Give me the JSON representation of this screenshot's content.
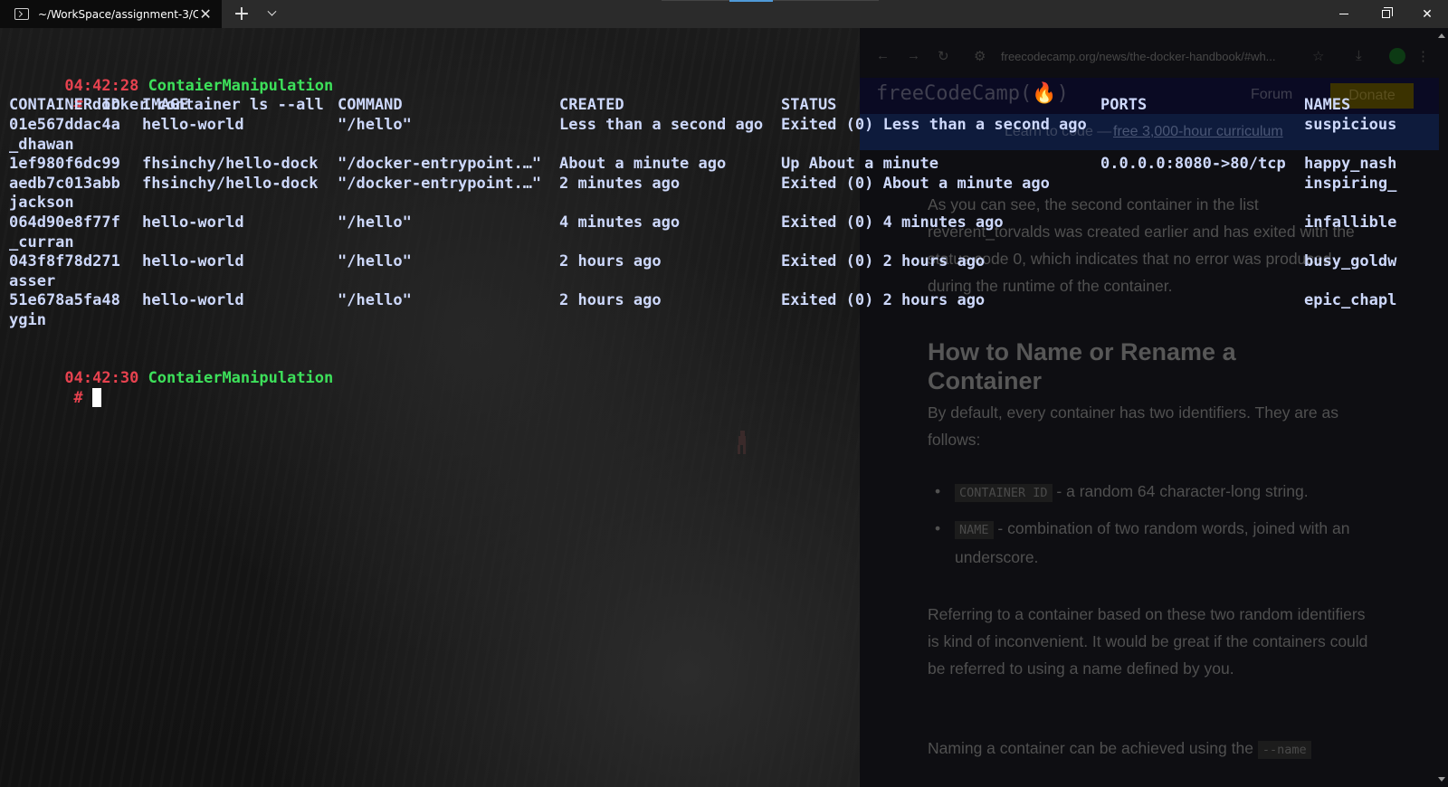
{
  "window": {
    "tab_title": "~/WorkSpace/assignment-3/C",
    "tab_close": "✕",
    "new_tab": "+",
    "close": "✕"
  },
  "terminal": {
    "prompt1": {
      "time": "04:42:28",
      "dir": "ContaierManipulation",
      "symbol": "#",
      "command": "docker container ls --all"
    },
    "headers": {
      "container_id": "CONTAINER ID",
      "image": "IMAGE",
      "command": "COMMAND",
      "created": "CREATED",
      "status": "STATUS",
      "ports": "PORTS",
      "names": "NAMES"
    },
    "rows": [
      {
        "id": "01e567ddac4a",
        "image": "hello-world",
        "command": "\"/hello\"",
        "created": "Less than a second ago",
        "status": "Exited (0) Less than a second ago",
        "ports": "",
        "name": "suspicious",
        "wrap": "_dhawan"
      },
      {
        "id": "1ef980f6dc99",
        "image": "fhsinchy/hello-dock",
        "command": "\"/docker-entrypoint.…\"",
        "created": "About a minute ago",
        "status": "Up About a minute",
        "ports": "0.0.0.0:8080->80/tcp",
        "name": "happy_nash",
        "wrap": ""
      },
      {
        "id": "aedb7c013abb",
        "image": "fhsinchy/hello-dock",
        "command": "\"/docker-entrypoint.…\"",
        "created": "2 minutes ago",
        "status": "Exited (0) About a minute ago",
        "ports": "",
        "name": "inspiring_",
        "wrap": "jackson"
      },
      {
        "id": "064d90e8f77f",
        "image": "hello-world",
        "command": "\"/hello\"",
        "created": "4 minutes ago",
        "status": "Exited (0) 4 minutes ago",
        "ports": "",
        "name": "infallible",
        "wrap": "_curran"
      },
      {
        "id": "043f8f78d271",
        "image": "hello-world",
        "command": "\"/hello\"",
        "created": "2 hours ago",
        "status": "Exited (0) 2 hours ago",
        "ports": "",
        "name": "busy_goldw",
        "wrap": "asser"
      },
      {
        "id": "51e678a5fa48",
        "image": "hello-world",
        "command": "\"/hello\"",
        "created": "2 hours ago",
        "status": "Exited (0) 2 hours ago",
        "ports": "",
        "name": "epic_chapl",
        "wrap": "ygin"
      }
    ],
    "prompt2": {
      "time": "04:42:30",
      "dir": "ContaierManipulation",
      "symbol": "#"
    }
  },
  "background_browser": {
    "url": "freecodecamp.org/news/the-docker-handbook/#wh...",
    "brand": "freeCodeCamp(🔥)",
    "forum": "Forum",
    "donate": "Donate",
    "banner_text": "Learn to code —",
    "banner_link": "free 3,000-hour curriculum",
    "para1": "As you can see, the second container in the list reverent_torvalds was created earlier and has exited with the status code 0, which indicates that no error was produced during the runtime of the container.",
    "heading": "How to Name or Rename a Container",
    "para2": "By default, every container has two identifiers. They are as follows:",
    "bullet1_code": "CONTAINER ID",
    "bullet1_text": "- a random 64 character-long string.",
    "bullet2_code": "NAME",
    "bullet2_text": "- combination of two random words, joined with an underscore.",
    "para3": "Referring to a container based on these two random identifiers is kind of inconvenient. It would be great if the containers could be referred to using a name defined by you.",
    "para4_text": "Naming a container can be achieved using the",
    "para4_code": "--name"
  },
  "colors": {
    "prompt_time": "#e7424f",
    "prompt_dir": "#3de05a",
    "output_text": "#cdd8fb",
    "titlebar": "#2b2b2b",
    "terminal_bg": "#0c0c0c"
  }
}
